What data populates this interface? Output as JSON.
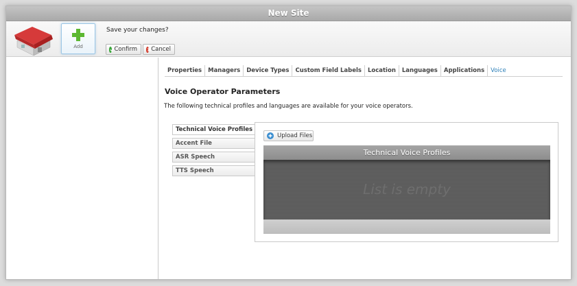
{
  "window": {
    "title": "New Site"
  },
  "toolbar": {
    "add_label": "Add",
    "save_prompt": "Save your changes?",
    "confirm_label": "Confirm",
    "cancel_label": "Cancel"
  },
  "tabs": [
    {
      "label": "Properties"
    },
    {
      "label": "Managers"
    },
    {
      "label": "Device Types"
    },
    {
      "label": "Custom Field Labels"
    },
    {
      "label": "Location"
    },
    {
      "label": "Languages"
    },
    {
      "label": "Applications"
    },
    {
      "label": "Voice"
    }
  ],
  "active_tab": "Voice",
  "voice": {
    "title": "Voice Operator Parameters",
    "description": "The following technical profiles and languages are available for your voice operators.",
    "side_items": [
      {
        "label": "Technical Voice Profiles"
      },
      {
        "label": "Accent File"
      },
      {
        "label": "ASR Speech"
      },
      {
        "label": "TTS Speech"
      }
    ],
    "upload_label": "Upload Files",
    "list_title": "Technical Voice Profiles",
    "empty_text": "List is empty"
  },
  "colors": {
    "accent": "#2c7fb8",
    "confirm_icon": "#3aa63a",
    "cancel_icon": "#d23a2a",
    "add_icon": "#5cb832"
  }
}
